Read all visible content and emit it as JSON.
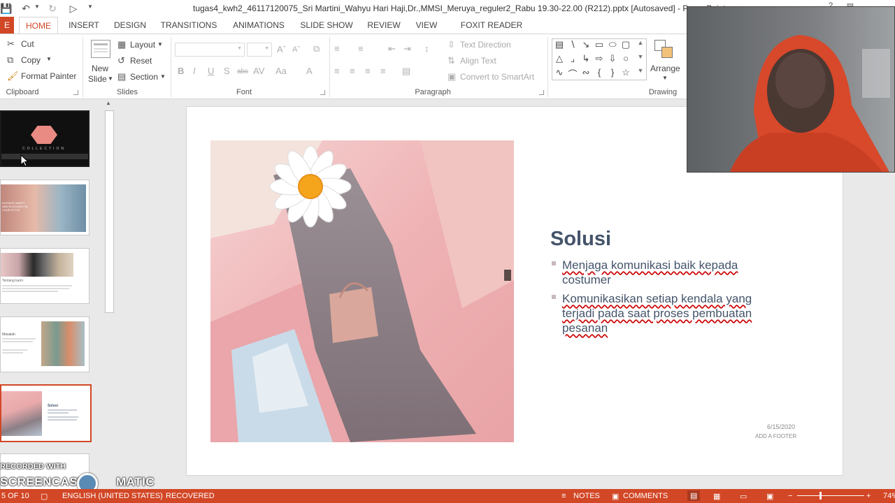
{
  "window": {
    "title": "tugas4_kwh2_46117120075_Sri Martini_Wahyu Hari Haji,Dr.,MMSI_Meruya_reguler2_Rabu 19.30-22.00 (R212).pptx [Autosaved] - PowerPoint"
  },
  "tabs": [
    "HOME",
    "INSERT",
    "DESIGN",
    "TRANSITIONS",
    "ANIMATIONS",
    "SLIDE SHOW",
    "REVIEW",
    "VIEW",
    "FOXIT READER PDF"
  ],
  "ribbon": {
    "clipboard": {
      "cut": "Cut",
      "copy": "Copy",
      "format_painter": "Format Painter",
      "label": "Clipboard"
    },
    "slides": {
      "new_slide_1": "New",
      "new_slide_2": "Slide",
      "layout": "Layout",
      "reset": "Reset",
      "section": "Section",
      "label": "Slides"
    },
    "font": {
      "label": "Font"
    },
    "paragraph": {
      "text_direction": "Text Direction",
      "align_text": "Align Text",
      "convert": "Convert to SmartArt",
      "label": "Paragraph"
    },
    "drawing": {
      "arrange": "Arrange",
      "label": "Drawing"
    }
  },
  "thumbnails": [
    {
      "caption": "COLLECTION"
    },
    {
      "caption": "ELEVATE VANITY AND ELEGANCY IN YOUR STYLE"
    },
    {
      "caption": "Tentang kami"
    },
    {
      "caption": "Masalah"
    },
    {
      "caption": "Solusi"
    }
  ],
  "slide": {
    "title": "Solusi",
    "bullets": [
      {
        "line1_plain": "",
        "line1_marked": "Menjaga komunikasi baik kepada",
        "line2_marked": "costumer"
      },
      {
        "line1_plain": "",
        "line1_marked": "Komunikasikan setiap kendala yang",
        "line2_marked": "terjadi pada saat proses pembuatan",
        "line3_marked": "pesanan"
      }
    ],
    "date": "6/15/2020",
    "footer": "ADD A FOOTER"
  },
  "watermark": {
    "line1": "RECORDED WITH",
    "line2_left": "SCREENCAST",
    "line2_right": "MATIC"
  },
  "status": {
    "slide_of": "5 OF 10",
    "language": "ENGLISH (UNITED STATES)",
    "recovered": "RECOVERED",
    "notes": "NOTES",
    "comments": "COMMENTS",
    "zoom": "74%"
  },
  "colors": {
    "accent": "#d24726",
    "title_text": "#44546a",
    "selected_thumb_border": "#d24726"
  }
}
